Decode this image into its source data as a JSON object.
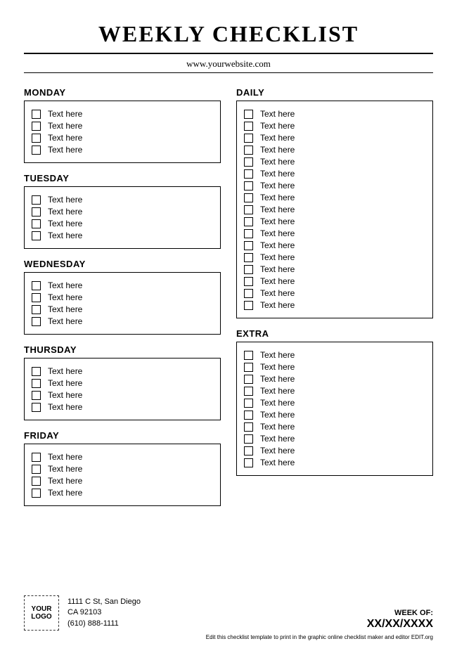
{
  "title": "WEEKLY CHECKLIST",
  "website": "www.yourwebsite.com",
  "left_sections": [
    {
      "title": "MONDAY",
      "items": [
        "Text here",
        "Text here",
        "Text here",
        "Text here"
      ]
    },
    {
      "title": "TUESDAY",
      "items": [
        "Text here",
        "Text here",
        "Text here",
        "Text here"
      ]
    },
    {
      "title": "WEDNESDAY",
      "items": [
        "Text here",
        "Text here",
        "Text here",
        "Text here"
      ]
    },
    {
      "title": "THURSDAY",
      "items": [
        "Text here",
        "Text here",
        "Text here",
        "Text here"
      ]
    },
    {
      "title": "FRIDAY",
      "items": [
        "Text here",
        "Text here",
        "Text here",
        "Text here"
      ]
    }
  ],
  "right_sections": [
    {
      "title": "DAILY",
      "items": [
        "Text here",
        "Text here",
        "Text here",
        "Text here",
        "Text here",
        "Text here",
        "Text here",
        "Text here",
        "Text here",
        "Text here",
        "Text here",
        "Text here",
        "Text here",
        "Text here",
        "Text here",
        "Text here",
        "Text here"
      ]
    },
    {
      "title": "EXTRA",
      "items": [
        "Text here",
        "Text here",
        "Text here",
        "Text here",
        "Text here",
        "Text here",
        "Text here",
        "Text here",
        "Text here",
        "Text here"
      ]
    }
  ],
  "footer": {
    "logo_line1": "YOUR",
    "logo_line2": "LOGO",
    "address_line1": "1111 C St, San Diego",
    "address_line2": "CA 92103",
    "phone": "(610) 888-1111",
    "week_label": "WEEK OF:",
    "week_value": "XX/XX/XXXX",
    "edit_note": "Edit this checklist template to print in the graphic online checklist maker and editor EDIT.org"
  }
}
